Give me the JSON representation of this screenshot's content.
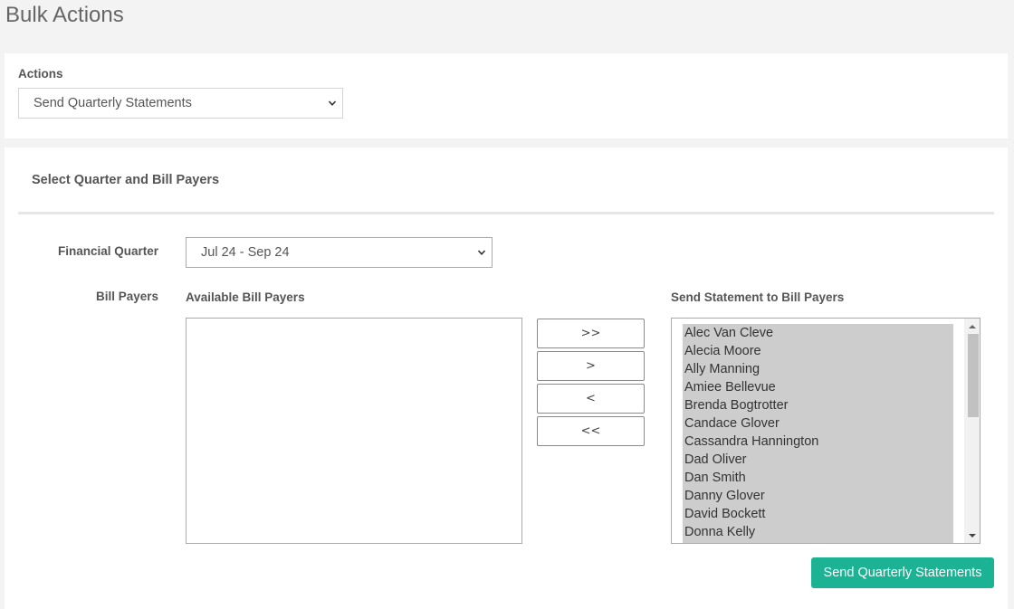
{
  "page": {
    "title": "Bulk Actions"
  },
  "actions_panel": {
    "label": "Actions",
    "selected": "Send Quarterly Statements"
  },
  "selection_panel": {
    "title": "Select Quarter and Bill Payers",
    "financial_quarter": {
      "label": "Financial Quarter",
      "selected": "Jul 24 - Sep 24"
    },
    "bill_payers": {
      "label": "Bill Payers",
      "available_heading": "Available Bill Payers",
      "available": [],
      "send_heading": "Send Statement to Bill Payers",
      "send_to": [
        "Alec Van Cleve",
        "Alecia Moore",
        "Ally Manning",
        "Amiee Bellevue",
        "Brenda Bogtrotter",
        "Candace Glover",
        "Cassandra Hannington",
        "Dad Oliver",
        "Dan Smith",
        "Danny Glover",
        "David Bockett",
        "Donna Kelly"
      ]
    },
    "move_buttons": {
      "move_all_right": ">>",
      "move_right": ">",
      "move_left": "<",
      "move_all_left": "<<"
    },
    "submit_label": "Send Quarterly Statements"
  },
  "colors": {
    "accent": "#1bb394",
    "background": "#f3f3f3",
    "selected_item_bg": "#cdcdcd"
  }
}
